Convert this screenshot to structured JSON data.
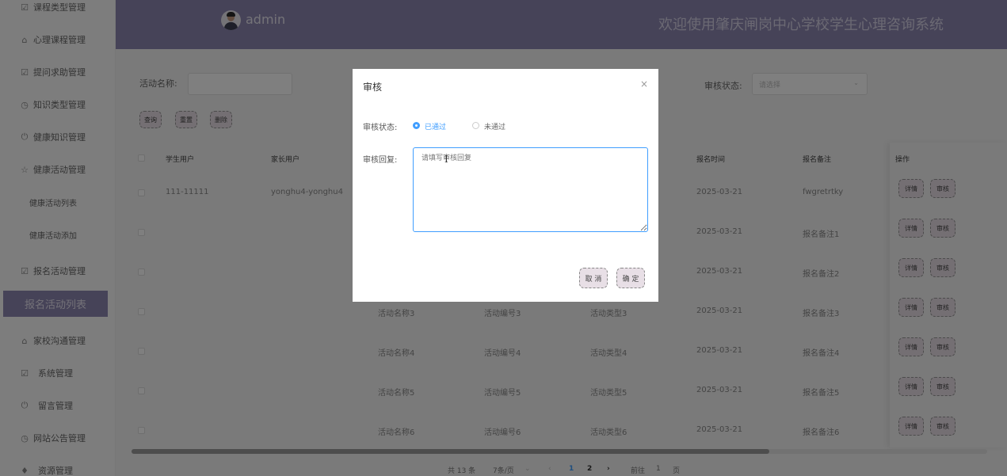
{
  "sidebar": {
    "items": [
      {
        "icon": "check-square-icon",
        "glyph": "☑",
        "label": "课程类型管理"
      },
      {
        "icon": "building-icon",
        "glyph": "⌂",
        "label": "心理课程管理"
      },
      {
        "icon": "check-square-icon",
        "glyph": "☑",
        "label": "提问求助管理"
      },
      {
        "icon": "clock-icon",
        "glyph": "◷",
        "label": "知识类型管理"
      },
      {
        "icon": "power-icon",
        "glyph": "⏻",
        "label": "健康知识管理"
      },
      {
        "icon": "star-icon",
        "glyph": "☆",
        "label": "健康活动管理"
      },
      {
        "icon": "",
        "glyph": "",
        "label": "健康活动列表"
      },
      {
        "icon": "",
        "glyph": "",
        "label": "健康活动添加"
      },
      {
        "icon": "check-square-icon",
        "glyph": "☑",
        "label": "报名活动管理"
      },
      {
        "icon": "",
        "glyph": "",
        "label": "报名活动列表"
      },
      {
        "icon": "building-icon",
        "glyph": "⌂",
        "label": "家校沟通管理"
      },
      {
        "icon": "check-square-icon",
        "glyph": "☑",
        "label": "系统管理"
      },
      {
        "icon": "power-icon",
        "glyph": "⏻",
        "label": "留言管理"
      },
      {
        "icon": "clock-icon",
        "glyph": "◷",
        "label": "网站公告管理"
      },
      {
        "icon": "diamond-icon",
        "glyph": "♦",
        "label": "资源管理"
      }
    ]
  },
  "header": {
    "admin_name": "admin",
    "site_title": "欢迎使用肇庆闸岗中心学校学生心理咨询系统"
  },
  "search": {
    "activity_name_label": "活动名称:",
    "activity_name_value": "",
    "review_status_label": "审核状态:",
    "review_status_placeholder": "请选择"
  },
  "toolbar": {
    "query_label": "查询",
    "reset_label": "重置",
    "delete_label": "删除"
  },
  "table": {
    "headers": {
      "student_user": "学生用户",
      "parent_user": "家长用户",
      "signup_time": "报名时间",
      "signup_note": "报名备注",
      "actions": "操作"
    },
    "rows": [
      {
        "student": "111-11111",
        "parent": "yonghu4-yonghu4",
        "name": "",
        "code": "",
        "type": "",
        "time": "2025-03-21",
        "note": "fwgretrtky"
      },
      {
        "student": "",
        "parent": "",
        "name": "",
        "code": "",
        "type": "",
        "time": "2025-03-21",
        "note": "报名备注1"
      },
      {
        "student": "",
        "parent": "",
        "name": "",
        "code": "",
        "type": "",
        "time": "2025-03-21",
        "note": "报名备注2"
      },
      {
        "student": "",
        "parent": "",
        "name": "活动名称3",
        "code": "活动编号3",
        "type": "活动类型3",
        "time": "2025-03-21",
        "note": "报名备注3"
      },
      {
        "student": "",
        "parent": "",
        "name": "活动名称4",
        "code": "活动编号4",
        "type": "活动类型4",
        "time": "2025-03-21",
        "note": "报名备注4"
      },
      {
        "student": "",
        "parent": "",
        "name": "活动名称5",
        "code": "活动编号5",
        "type": "活动类型5",
        "time": "2025-03-21",
        "note": "报名备注5"
      },
      {
        "student": "",
        "parent": "",
        "name": "活动名称6",
        "code": "活动编号6",
        "type": "活动类型6",
        "time": "2025-03-21",
        "note": "报名备注6"
      }
    ],
    "detail_label": "详情",
    "review_label": "审核"
  },
  "pagination": {
    "total": "共 13 条",
    "page_size": "7条/页",
    "pages": [
      "1",
      "2"
    ],
    "current_page": "1",
    "goto_prefix": "前往",
    "goto_value": "1",
    "goto_suffix": "页"
  },
  "dialog": {
    "title": "审核",
    "status_label": "审核状态:",
    "option_passed": "已通过",
    "option_failed": "未通过",
    "selected": "已通过",
    "reply_label": "审核回复:",
    "reply_placeholder": "请填写审核回复",
    "cancel_label": "取 消",
    "confirm_label": "确 定"
  },
  "colors": {
    "header_bg": "#8c86b0",
    "accent_blue": "#409eff",
    "button_bg": "#e8dfe6"
  }
}
